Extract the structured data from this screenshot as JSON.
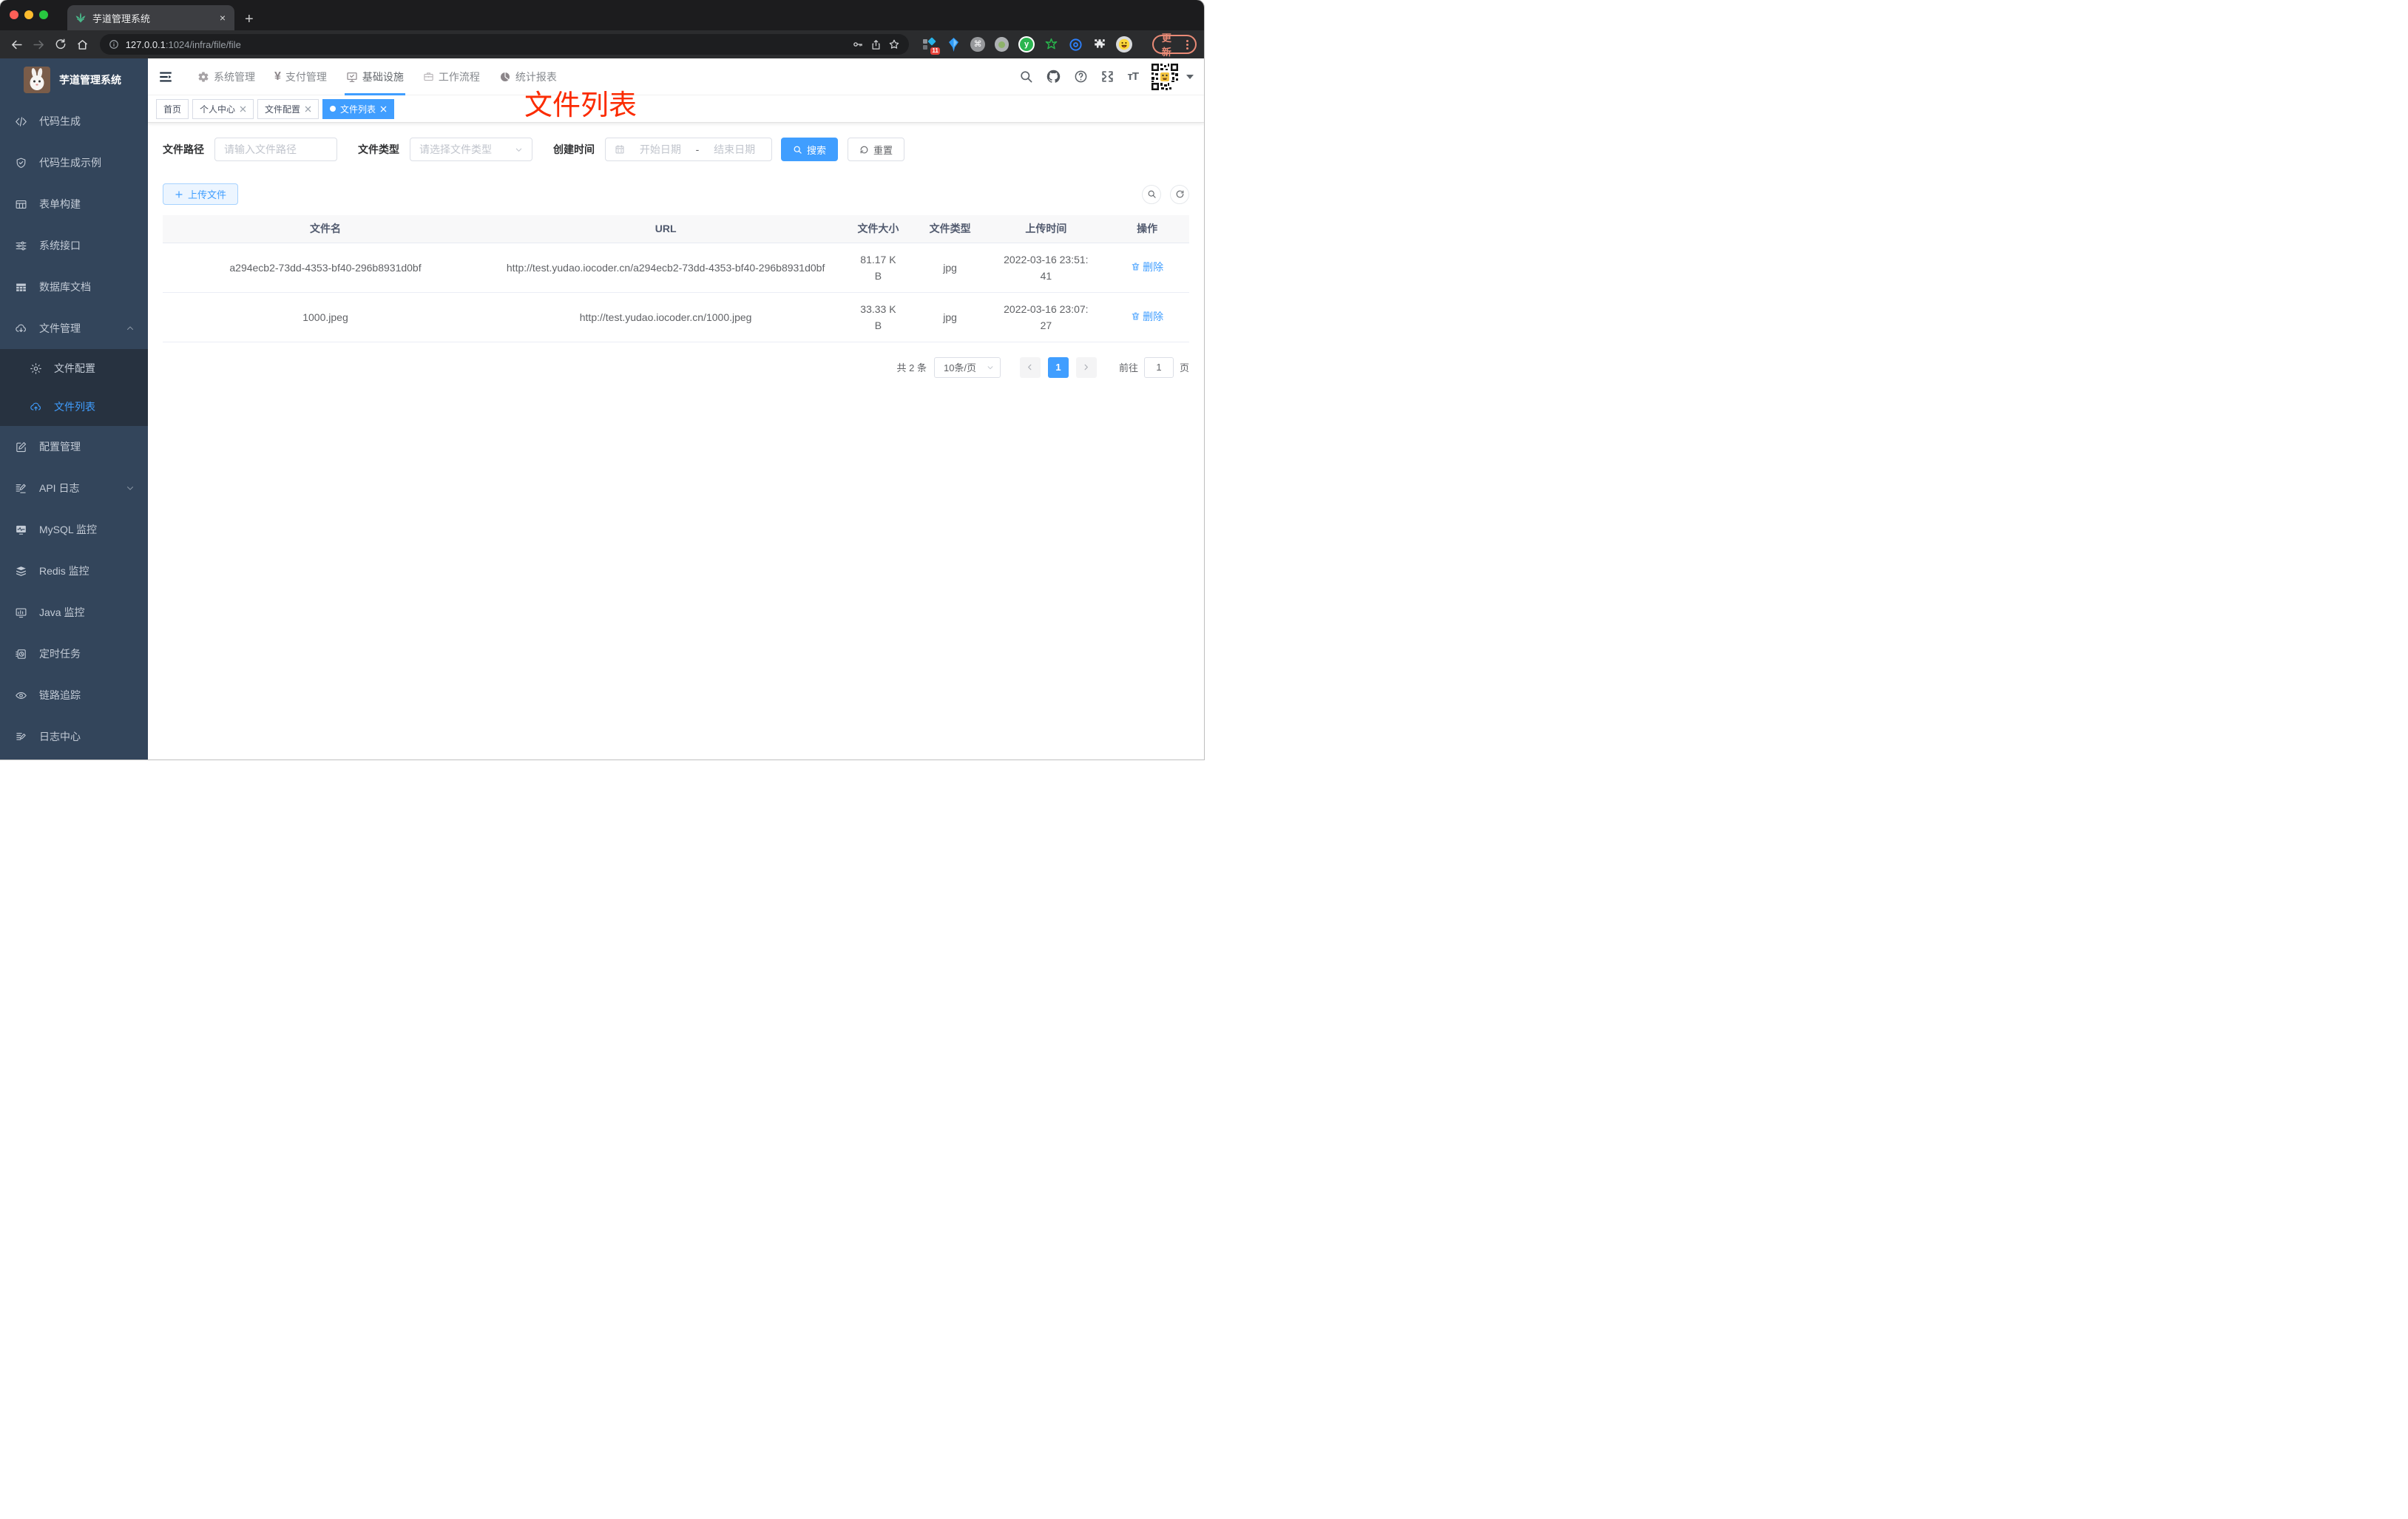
{
  "browser": {
    "tab_title": "芋道管理系统",
    "close_tab": "×",
    "new_tab": "+",
    "url_host": "127.0.0.1",
    "url_rest": ":1024/infra/file/file",
    "ext_badge": "11",
    "update_label": "更新"
  },
  "sidebar": {
    "title": "芋道管理系统",
    "items": [
      {
        "label": "代码生成"
      },
      {
        "label": "代码生成示例"
      },
      {
        "label": "表单构建"
      },
      {
        "label": "系统接口"
      },
      {
        "label": "数据库文档"
      },
      {
        "label": "文件管理"
      },
      {
        "label": "文件配置"
      },
      {
        "label": "文件列表"
      },
      {
        "label": "配置管理"
      },
      {
        "label": "API 日志"
      },
      {
        "label": "MySQL 监控"
      },
      {
        "label": "Redis 监控"
      },
      {
        "label": "Java 监控"
      },
      {
        "label": "定时任务"
      },
      {
        "label": "链路追踪"
      },
      {
        "label": "日志中心"
      }
    ]
  },
  "topnav": {
    "items": [
      {
        "label": "系统管理"
      },
      {
        "label": "支付管理"
      },
      {
        "label": "基础设施"
      },
      {
        "label": "工作流程"
      },
      {
        "label": "统计报表"
      }
    ]
  },
  "tags": {
    "items": [
      {
        "label": "首页"
      },
      {
        "label": "个人中心"
      },
      {
        "label": "文件配置"
      },
      {
        "label": "文件列表"
      }
    ]
  },
  "annotation": "文件列表",
  "filters": {
    "path_label": "文件路径",
    "path_placeholder": "请输入文件路径",
    "type_label": "文件类型",
    "type_placeholder": "请选择文件类型",
    "date_label": "创建时间",
    "date_start": "开始日期",
    "date_sep": "-",
    "date_end": "结束日期",
    "search_label": "搜索",
    "reset_label": "重置"
  },
  "actions": {
    "upload_label": "上传文件"
  },
  "table": {
    "headers": [
      "文件名",
      "URL",
      "文件大小",
      "文件类型",
      "上传时间",
      "操作"
    ],
    "rows": [
      {
        "name": "a294ecb2-73dd-4353-bf40-296b8931d0bf",
        "url": "http://test.yudao.iocoder.cn/a294ecb2-73dd-4353-bf40-296b8931d0bf",
        "size": "81.17 KB",
        "type": "jpg",
        "time": "2022-03-16 23:51:41",
        "action": "删除"
      },
      {
        "name": "1000.jpeg",
        "url": "http://test.yudao.iocoder.cn/1000.jpeg",
        "size": "33.33 KB",
        "type": "jpg",
        "time": "2022-03-16 23:07:27",
        "action": "删除"
      }
    ]
  },
  "pagination": {
    "total": "共 2 条",
    "page_size": "10条/页",
    "page": "1",
    "goto_label": "前往",
    "goto_value": "1",
    "unit": "页"
  },
  "colors": {
    "accent": "#409eff",
    "annotation_red": "#fb2b01"
  }
}
